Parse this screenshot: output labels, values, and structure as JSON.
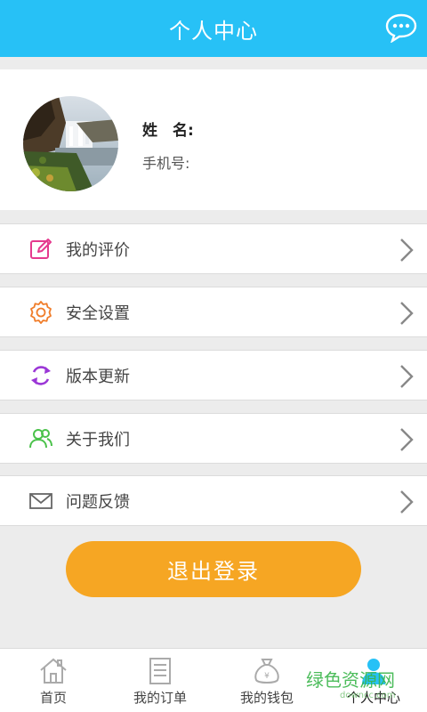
{
  "header": {
    "title": "个人中心",
    "message_icon": "chat-bubble-icon"
  },
  "profile": {
    "name_label": "姓　名:",
    "phone_label": "手机号:"
  },
  "menu": [
    {
      "label": "我的评价",
      "icon": "edit-icon",
      "color": "#e53a8e"
    },
    {
      "label": "安全设置",
      "icon": "gear-icon",
      "color": "#f07d2a"
    },
    {
      "label": "版本更新",
      "icon": "refresh-icon",
      "color": "#9b37d6"
    },
    {
      "label": "关于我们",
      "icon": "users-icon",
      "color": "#4bc24b"
    },
    {
      "label": "问题反馈",
      "icon": "mail-icon",
      "color": "#666666"
    }
  ],
  "logout_label": "退出登录",
  "tabs": [
    {
      "label": "首页",
      "icon": "home-icon"
    },
    {
      "label": "我的订单",
      "icon": "order-icon"
    },
    {
      "label": "我的钱包",
      "icon": "wallet-icon"
    },
    {
      "label": "个人中心",
      "icon": "person-icon",
      "active": true
    }
  ],
  "watermark": {
    "text": "绿色资源网",
    "sub": "downcc.com"
  },
  "colors": {
    "accent": "#27c1f6",
    "logout": "#f6a623"
  }
}
